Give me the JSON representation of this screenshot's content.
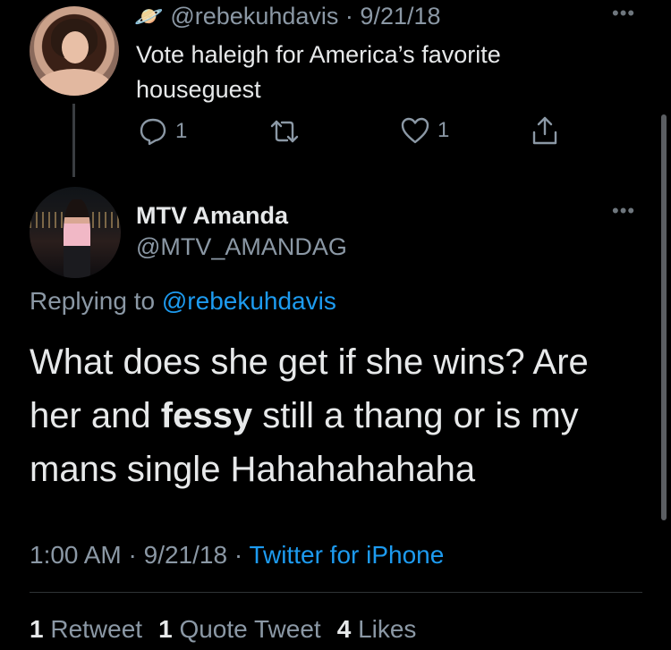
{
  "parent_tweet": {
    "handle": "@rebekuhdavis",
    "separator": "·",
    "date": "9/21/18",
    "text_line1": "Vote haleigh for America’s favorite",
    "text_line2": "houseguest",
    "more_label": "•••",
    "reply_count": "1",
    "like_count": "1",
    "badge_emoji": "🪐"
  },
  "reply_tweet": {
    "display_name": "MTV Amanda",
    "handle": "@MTV_AMANDAG",
    "more_label": "•••",
    "replying_prefix": "Replying to",
    "replying_to": "@rebekuhdavis",
    "text_before": "What does she get if she wins? Are her and ",
    "text_bold": "fessy",
    "text_after": " still a thang or is my mans single Hahahahahaha",
    "time": "1:00 AM",
    "date": "9/21/18",
    "separator": "·",
    "source": "Twitter for iPhone",
    "stats": {
      "retweets_count": "1",
      "retweets_label": "Retweet",
      "quotes_count": "1",
      "quotes_label": "Quote Tweet",
      "likes_count": "4",
      "likes_label": "Likes"
    }
  },
  "icons": {
    "reply": "reply-icon",
    "retweet": "retweet-icon",
    "like": "heart-icon",
    "share": "share-icon",
    "more": "more-icon"
  },
  "colors": {
    "background": "#000000",
    "text_primary": "#e7e9ea",
    "text_secondary": "#8b98a5",
    "link": "#1d9bf0",
    "divider": "#2f3336"
  }
}
